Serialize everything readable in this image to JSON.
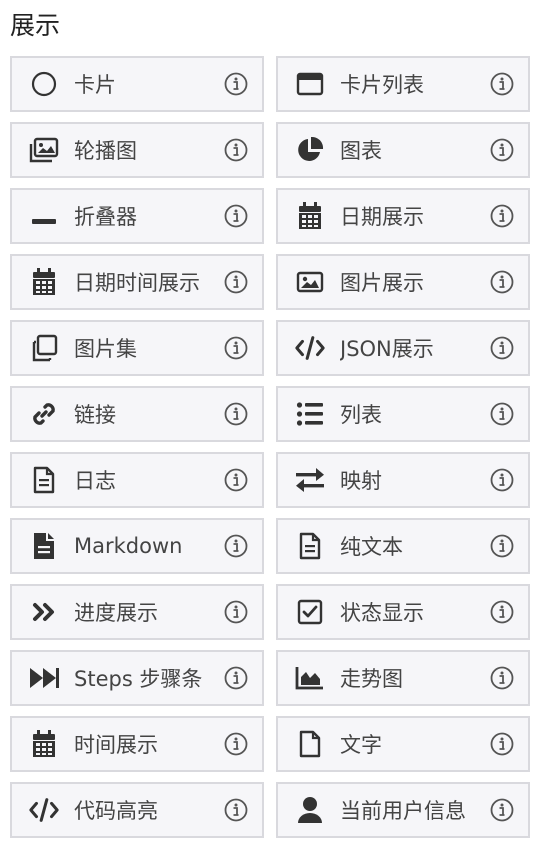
{
  "section": {
    "title": "展示"
  },
  "items": [
    {
      "label": "卡片",
      "icon": "circle-icon"
    },
    {
      "label": "卡片列表",
      "icon": "window-icon"
    },
    {
      "label": "轮播图",
      "icon": "images-icon"
    },
    {
      "label": "图表",
      "icon": "pie-chart-icon"
    },
    {
      "label": "折叠器",
      "icon": "minus-icon"
    },
    {
      "label": "日期展示",
      "icon": "calendar-icon"
    },
    {
      "label": "日期时间展示",
      "icon": "calendar-icon"
    },
    {
      "label": "图片展示",
      "icon": "image-icon"
    },
    {
      "label": "图片集",
      "icon": "clone-icon"
    },
    {
      "label": "JSON展示",
      "icon": "code-icon"
    },
    {
      "label": "链接",
      "icon": "link-icon"
    },
    {
      "label": "列表",
      "icon": "list-icon"
    },
    {
      "label": "日志",
      "icon": "file-lines-icon"
    },
    {
      "label": "映射",
      "icon": "exchange-icon"
    },
    {
      "label": "Markdown",
      "icon": "file-text-icon"
    },
    {
      "label": "纯文本",
      "icon": "file-lines-icon"
    },
    {
      "label": "进度展示",
      "icon": "angle-double-right-icon"
    },
    {
      "label": "状态显示",
      "icon": "check-square-icon"
    },
    {
      "label": "Steps 步骤条",
      "icon": "forward-icon"
    },
    {
      "label": "走势图",
      "icon": "area-chart-icon"
    },
    {
      "label": "时间展示",
      "icon": "calendar-icon"
    },
    {
      "label": "文字",
      "icon": "file-icon"
    },
    {
      "label": "代码高亮",
      "icon": "code-icon"
    },
    {
      "label": "当前用户信息",
      "icon": "user-icon"
    }
  ],
  "info_icon": "info-circle-icon",
  "colors": {
    "icon": "#333333",
    "border": "#d9d9de",
    "tile_bg": "#f6f6f9"
  }
}
